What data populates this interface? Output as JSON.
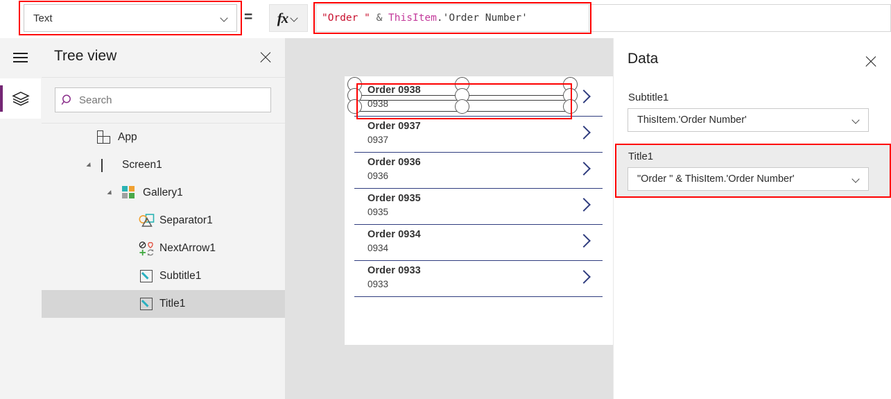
{
  "formula_bar": {
    "property_select": {
      "value": "Text",
      "icon": "chevron-down-icon"
    },
    "equals": "=",
    "fx_label": "fx",
    "formula_tokens": [
      {
        "text": "\"Order \"",
        "kind": "string"
      },
      {
        "text": " & ",
        "kind": "operator"
      },
      {
        "text": "ThisItem",
        "kind": "identifier"
      },
      {
        "text": ".'Order Number'",
        "kind": "plain"
      }
    ],
    "formula_plain": "\"Order \" & ThisItem.'Order Number'",
    "colors": {
      "string": "#c8102e",
      "operator": "#5c5c5c",
      "identifier": "#c3399b",
      "plain": "#3b3b3b",
      "highlight_box": "#fe0000"
    }
  },
  "rail": {
    "menu_icon": "hamburger-icon",
    "layers_icon": "layers-icon",
    "accent_color": "#742774"
  },
  "tree_view": {
    "title": "Tree view",
    "close_icon": "close-icon",
    "search": {
      "placeholder": "Search",
      "value": "",
      "icon": "search-icon"
    },
    "items": [
      {
        "label": "App",
        "icon": "app-icon",
        "indent": 0,
        "caret": "",
        "selected": false
      },
      {
        "label": "Screen1",
        "icon": "screen-icon",
        "indent": 1,
        "caret": "down",
        "selected": false
      },
      {
        "label": "Gallery1",
        "icon": "gallery-icon",
        "indent": 2,
        "caret": "down",
        "selected": false
      },
      {
        "label": "Separator1",
        "icon": "shapes-icon",
        "indent": 3,
        "caret": "",
        "selected": false
      },
      {
        "label": "NextArrow1",
        "icon": "icons-icon",
        "indent": 3,
        "caret": "",
        "selected": false
      },
      {
        "label": "Subtitle1",
        "icon": "text-label-icon",
        "indent": 3,
        "caret": "",
        "selected": false
      },
      {
        "label": "Title1",
        "icon": "text-label-icon",
        "indent": 3,
        "caret": "",
        "selected": true
      }
    ]
  },
  "canvas": {
    "gallery": {
      "items": [
        {
          "title": "Order 0938",
          "subtitle": "0938",
          "chevron": "chevron-right-icon",
          "selected": true
        },
        {
          "title": "Order 0937",
          "subtitle": "0937",
          "chevron": "chevron-right-icon",
          "selected": false
        },
        {
          "title": "Order 0936",
          "subtitle": "0936",
          "chevron": "chevron-right-icon",
          "selected": false
        },
        {
          "title": "Order 0935",
          "subtitle": "0935",
          "chevron": "chevron-right-icon",
          "selected": false
        },
        {
          "title": "Order 0934",
          "subtitle": "0934",
          "chevron": "chevron-right-icon",
          "selected": false
        },
        {
          "title": "Order 0933",
          "subtitle": "0933",
          "chevron": "chevron-right-icon",
          "selected": false
        }
      ],
      "separator_color": "#2f3c7e",
      "chevron_color": "#2f3c7e"
    }
  },
  "data_panel": {
    "title": "Data",
    "close_icon": "close-icon",
    "fields": [
      {
        "label": "Subtitle1",
        "value": "ThisItem.'Order Number'",
        "highlighted": false
      },
      {
        "label": "Title1",
        "value": "\"Order \" & ThisItem.'Order Number'",
        "highlighted": true
      }
    ]
  }
}
